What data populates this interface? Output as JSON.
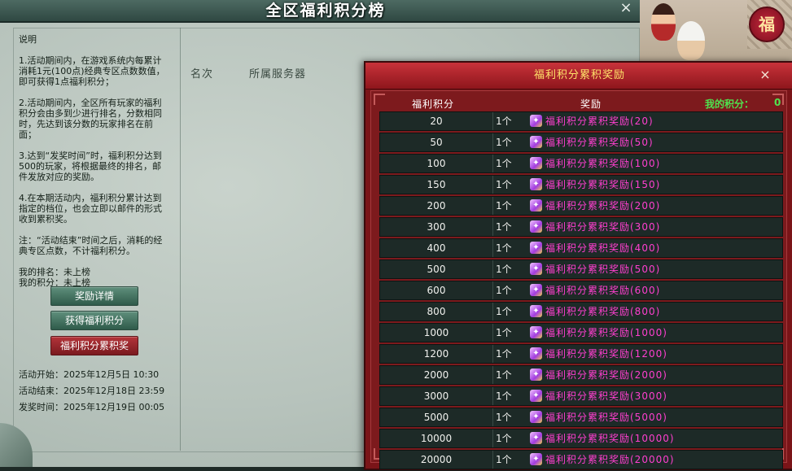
{
  "window": {
    "title": "全区福利积分榜",
    "close": "×"
  },
  "explain": {
    "heading": "说明",
    "rules": [
      "1.活动期间内，在游戏系统内每累计消耗1元(100点)经典专区点数数值，即可获得1点福利积分；",
      "2.活动期间内，全区所有玩家的福利积分会由多到少进行排名，分数相同时，先达到该分数的玩家排名在前面；",
      "3.达到“发奖时间”时，福利积分达到500的玩家，将根据最终的排名，邮件发放对应的奖励。",
      "4.在本期活动内，福利积分累计达到指定的档位，也会立即以邮件的形式收到累积奖。",
      "注：“活动结束”时间之后，消耗的经典专区点数，不计福利积分。"
    ],
    "my_rank": "我的排名：未上榜",
    "my_points": "我的积分：未上榜"
  },
  "buttons": {
    "reward_details": "奖励详情",
    "get_points": "获得福利积分",
    "cumulative_reward": "福利积分累积奖"
  },
  "times": {
    "start": "活动开始：2025年12月5日  10:30",
    "end": "活动结束：2025年12月18日  23:59",
    "award": "发奖时间：2025年12月19日  00:05"
  },
  "ranking": {
    "col_rank": "名次",
    "col_server": "所属服务器"
  },
  "decoration": {
    "badge": "福"
  },
  "popup": {
    "title": "福利积分累积奖励",
    "close": "×",
    "col_points": "福利积分",
    "col_reward": "奖励",
    "my_points_label": "我的积分：",
    "my_points_value": "0",
    "gift_icon": "gift-box-icon",
    "rows": [
      {
        "points": "20",
        "qty": "1个",
        "reward": "福利积分累积奖励(20)"
      },
      {
        "points": "50",
        "qty": "1个",
        "reward": "福利积分累积奖励(50)"
      },
      {
        "points": "100",
        "qty": "1个",
        "reward": "福利积分累积奖励(100)"
      },
      {
        "points": "150",
        "qty": "1个",
        "reward": "福利积分累积奖励(150)"
      },
      {
        "points": "200",
        "qty": "1个",
        "reward": "福利积分累积奖励(200)"
      },
      {
        "points": "300",
        "qty": "1个",
        "reward": "福利积分累积奖励(300)"
      },
      {
        "points": "400",
        "qty": "1个",
        "reward": "福利积分累积奖励(400)"
      },
      {
        "points": "500",
        "qty": "1个",
        "reward": "福利积分累积奖励(500)"
      },
      {
        "points": "600",
        "qty": "1个",
        "reward": "福利积分累积奖励(600)"
      },
      {
        "points": "800",
        "qty": "1个",
        "reward": "福利积分累积奖励(800)"
      },
      {
        "points": "1000",
        "qty": "1个",
        "reward": "福利积分累积奖励(1000)"
      },
      {
        "points": "1200",
        "qty": "1个",
        "reward": "福利积分累积奖励(1200)"
      },
      {
        "points": "2000",
        "qty": "1个",
        "reward": "福利积分累积奖励(2000)"
      },
      {
        "points": "3000",
        "qty": "1个",
        "reward": "福利积分累积奖励(3000)"
      },
      {
        "points": "5000",
        "qty": "1个",
        "reward": "福利积分累积奖励(5000)"
      },
      {
        "points": "10000",
        "qty": "1个",
        "reward": "福利积分累积奖励(10000)"
      },
      {
        "points": "20000",
        "qty": "1个",
        "reward": "福利积分累积奖励(20000)"
      }
    ]
  }
}
